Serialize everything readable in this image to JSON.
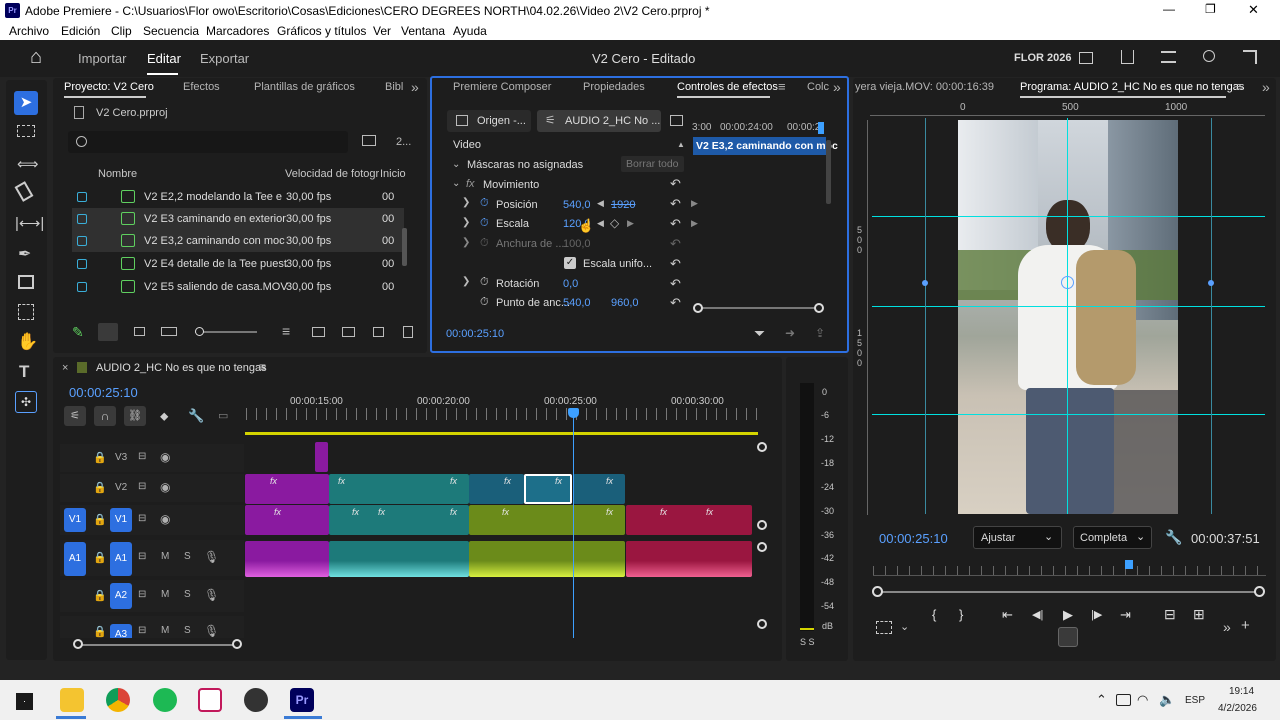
{
  "window": {
    "title": "Adobe Premiere - C:\\Usuarios\\Flor owo\\Escritorio\\Cosas\\Ediciones\\CERO DEGREES NORTH\\04.02.26\\Video 2\\V2 Cero.prproj *",
    "minimize": "—",
    "maximize": "❐",
    "close": "✕"
  },
  "menu": [
    "Archivo",
    "Edición",
    "Clip",
    "Secuencia",
    "Marcadores",
    "Gráficos y títulos",
    "Ver",
    "Ventana",
    "Ayuda"
  ],
  "header": {
    "home": "⌂",
    "tabs": [
      "Importar",
      "Editar",
      "Exportar"
    ],
    "active": "Editar",
    "center_title": "V2 Cero - Editado",
    "workspace": "FLOR 2026"
  },
  "project": {
    "tabs": [
      "Proyecto: V2 Cero",
      "Efectos",
      "Plantillas de gráficos",
      "Bibl"
    ],
    "more": "»",
    "file": "V2 Cero.prproj",
    "count": "2...",
    "columns": [
      "Nombre",
      "Velocidad de fotogr",
      "Inicio"
    ],
    "items": [
      {
        "name": "V2 E2,2 modelando la Tee e",
        "fps": "30,00 fps",
        "start": "00"
      },
      {
        "name": "V2 E3 caminando en exterior",
        "fps": "30,00 fps",
        "start": "00"
      },
      {
        "name": "V2 E3,2 caminando con moc",
        "fps": "30,00 fps",
        "start": "00"
      },
      {
        "name": "V2 E4 detalle de la Tee puest",
        "fps": "30,00 fps",
        "start": "00"
      },
      {
        "name": "V2 E5 saliendo de casa.MOV",
        "fps": "30,00 fps",
        "start": "00"
      }
    ]
  },
  "effects": {
    "tabs": [
      "Premiere Composer",
      "Propiedades",
      "Controles de efectos",
      "Colc"
    ],
    "more": "»",
    "source_tab": "Origen -...",
    "clip_tab": "AUDIO 2_HC No ...",
    "clip_label": "V2 E3,2 caminando con moc",
    "ruler": [
      "3:00",
      "00:00:24:00",
      "00:00:2"
    ],
    "video_header": "Video",
    "masks": "Máscaras no asignadas",
    "clear_all": "Borrar todo",
    "motion": "Movimiento",
    "params": [
      {
        "name": "Posición",
        "v1": "540,0",
        "v2": "1920"
      },
      {
        "name": "Escala",
        "v1": "120,0",
        "v2": ""
      },
      {
        "name": "Anchura de ...",
        "v1": "100,0",
        "v2": ""
      }
    ],
    "uniform": "Escala unifo...",
    "rotation": {
      "name": "Rotación",
      "v1": "0,0"
    },
    "anchor": {
      "name": "Punto de anc...",
      "v1": "540,0",
      "v2": "960,0"
    },
    "timecode": "00:00:25:10"
  },
  "program": {
    "source_label": "yera vieja.MOV: 00:00:16:39",
    "title": "Programa: AUDIO 2_HC No es que no tengas",
    "ruler": [
      "0",
      "500",
      "1000"
    ],
    "vruler": [
      "5",
      "0",
      "0",
      "1",
      "5",
      "0",
      "0"
    ],
    "timecode": "00:00:25:10",
    "fit": "Ajustar",
    "quality": "Completa",
    "duration": "00:00:37:51",
    "controls": [
      "{",
      "}",
      "⇤",
      "◀|",
      "▶",
      "|▶",
      "⇥",
      "⊟",
      "⊞"
    ]
  },
  "timeline": {
    "sequence": "AUDIO 2_HC No es que no tengas",
    "timecode": "00:00:25:10",
    "ruler": [
      "00:00:15:00",
      "00:00:20:00",
      "00:00:25:00",
      "00:00:30:00"
    ],
    "tracks": [
      {
        "id": "V3",
        "target": ""
      },
      {
        "id": "V2",
        "target": ""
      },
      {
        "id": "V1",
        "target": "V1"
      },
      {
        "id": "A1",
        "target": "A1"
      },
      {
        "id": "A2",
        "target": ""
      },
      {
        "id": "A3",
        "target": ""
      }
    ],
    "fx": "fx",
    "m": "M",
    "s": "S"
  },
  "meter": {
    "labels": [
      "0",
      "-6",
      "-12",
      "-18",
      "-24",
      "-30",
      "-36",
      "-42",
      "-48",
      "-54",
      "dB"
    ],
    "solo": "S S"
  },
  "taskbar": {
    "lang": "ESP",
    "time": "19:14",
    "date": "4/2/2026",
    "up": "⌃"
  },
  "colors": {
    "accent": "#2d8ceb",
    "teal": "#1d7a7a",
    "purple": "#8a1aa0",
    "olive": "#6b8b1a",
    "crimson": "#9a1640",
    "cyan_guides": "#00e0e0",
    "playhead": "#3da0ff"
  }
}
